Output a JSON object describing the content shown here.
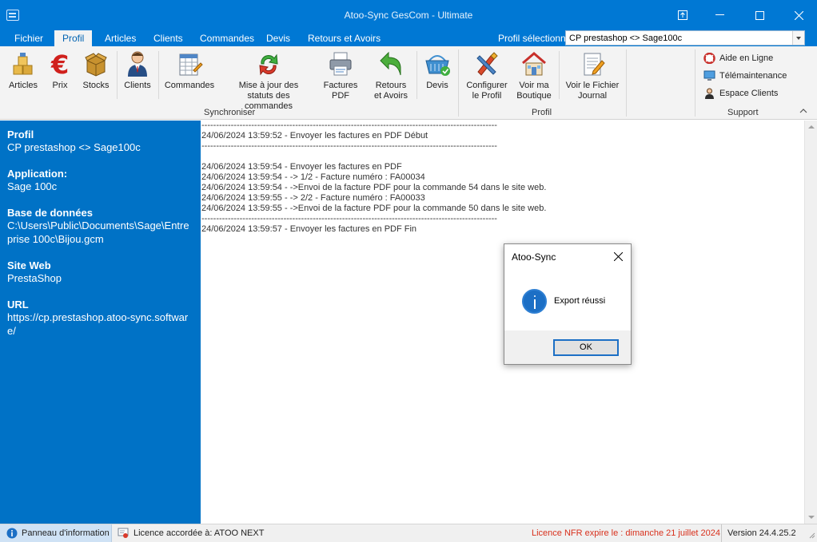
{
  "window": {
    "title": "Atoo-Sync GesCom - Ultimate"
  },
  "menu": {
    "tabs": [
      "Fichier",
      "Profil",
      "Articles",
      "Clients",
      "Commandes",
      "Devis",
      "Retours et Avoirs"
    ],
    "active_tab": "Profil",
    "profile_label": "Profil sélectionné",
    "profile_value": "CP prestashop <> Sage100c"
  },
  "ribbon": {
    "buttons": {
      "articles": "Articles",
      "prix": "Prix",
      "stocks": "Stocks",
      "clients": "Clients",
      "commandes": "Commandes",
      "maj_statuts_1": "Mise à jour des",
      "maj_statuts_2": "statuts des commandes",
      "factures_1": "Factures",
      "factures_2": "PDF",
      "retours_1": "Retours",
      "retours_2": "et Avoirs",
      "devis": "Devis",
      "configurer_1": "Configurer",
      "configurer_2": "le Profil",
      "boutique_1": "Voir ma",
      "boutique_2": "Boutique",
      "journal_1": "Voir le Fichier",
      "journal_2": "Journal"
    },
    "groups": {
      "synchroniser": "Synchroniser",
      "profil": "Profil",
      "support": "Support"
    },
    "support_items": [
      "Aide en Ligne",
      "Télémaintenance",
      "Espace Clients"
    ]
  },
  "info_panel": {
    "sections": [
      {
        "label": "Profil",
        "value": "CP prestashop <> Sage100c"
      },
      {
        "label": "Application:",
        "value": "Sage 100c"
      },
      {
        "label": "Base de données",
        "value": "C:\\Users\\Public\\Documents\\Sage\\Entreprise 100c\\Bijou.gcm"
      },
      {
        "label": "Site Web",
        "value": "PrestaShop"
      },
      {
        "label": "URL",
        "value": "https://cp.prestashop.atoo-sync.software/"
      }
    ]
  },
  "log": {
    "lines": [
      "-----------------------------------------------------------------------------------------------------",
      "24/06/2024 13:59:52 - Envoyer les factures en PDF Début",
      "-----------------------------------------------------------------------------------------------------",
      "",
      "24/06/2024 13:59:54 - Envoyer les factures en PDF",
      "24/06/2024 13:59:54 - -> 1/2 - Facture numéro : FA00034",
      "24/06/2024 13:59:54 - ->Envoi de la facture PDF pour la commande 54 dans le site web.",
      "24/06/2024 13:59:55 - -> 2/2 - Facture numéro : FA00033",
      "24/06/2024 13:59:55 - ->Envoi de la facture PDF pour la commande 50 dans le site web.",
      "-----------------------------------------------------------------------------------------------------",
      "24/06/2024 13:59:57 - Envoyer les factures en PDF Fin"
    ]
  },
  "dialog": {
    "title": "Atoo-Sync",
    "message": "Export réussi",
    "ok_label": "OK"
  },
  "statusbar": {
    "info_panel_label": "Panneau d'information",
    "licence": "Licence accordée à: ATOO NEXT",
    "expiry": "Licence NFR expire le : dimanche 21 juillet 2024",
    "version": "Version 24.4.25.2"
  },
  "colors": {
    "accent": "#0078d4",
    "panel": "#0072c6",
    "expiry_text": "#d8301c"
  }
}
